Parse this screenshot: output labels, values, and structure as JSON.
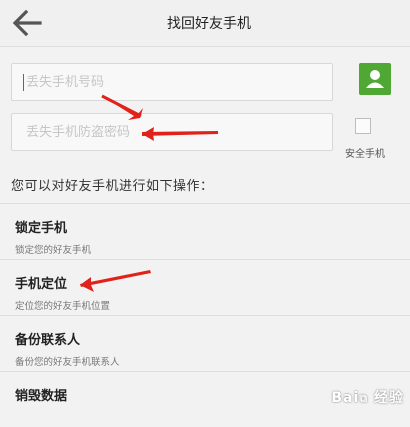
{
  "header": {
    "title": "找回好友手机"
  },
  "form": {
    "phone_placeholder": "丢失手机号码",
    "password_placeholder": "丢失手机防盗密码",
    "secure_phone_label": "安全手机"
  },
  "section_title": "您可以对好友手机进行如下操作：",
  "actions": [
    {
      "title": "锁定手机",
      "subtitle": "锁定您的好友手机"
    },
    {
      "title": "手机定位",
      "subtitle": "定位您的好友手机位置"
    },
    {
      "title": "备份联系人",
      "subtitle": "备份您的好友手机联系人"
    },
    {
      "title": "销毁数据",
      "subtitle": ""
    }
  ],
  "watermark": "Bai 经验",
  "colors": {
    "accent_green": "#4fa834",
    "arrow_red": "#e0221b"
  }
}
